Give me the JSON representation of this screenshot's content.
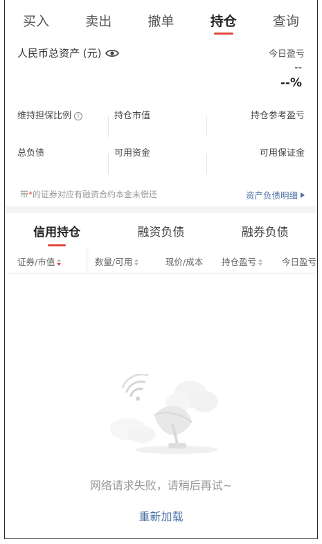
{
  "top_tabs": [
    {
      "label": "买入"
    },
    {
      "label": "卖出"
    },
    {
      "label": "撤单"
    },
    {
      "label": "持仓"
    },
    {
      "label": "查询"
    }
  ],
  "active_top_tab": "持仓",
  "assets": {
    "total_label": "人民币总资产 (元)",
    "today_label": "今日盈亏",
    "today_value": "--",
    "today_pct": "--%"
  },
  "metrics": {
    "maintenance_ratio": "维持担保比例",
    "position_value": "持仓市值",
    "position_ref_pl": "持仓参考盈亏",
    "total_liability": "总负债",
    "available_funds": "可用资金",
    "available_margin": "可用保证金"
  },
  "note": {
    "prefix": "带",
    "star": "*",
    "suffix": "的证券对应有融资合约本金未偿还"
  },
  "detail_link": "资产负债明细",
  "sub_tabs": [
    {
      "label": "信用持仓"
    },
    {
      "label": "融资负债"
    },
    {
      "label": "融券负债"
    }
  ],
  "columns": [
    {
      "label": "证券/市值"
    },
    {
      "label": "数量/可用"
    },
    {
      "label": "现价/成本"
    },
    {
      "label": "持仓盈亏"
    },
    {
      "label": "今日盈亏"
    }
  ],
  "empty": {
    "message": "网络请求失败，请稍后再试~",
    "reload": "重新加载"
  },
  "colors": {
    "accent_red": "#e2473d",
    "link_blue": "#4a6fa5"
  }
}
